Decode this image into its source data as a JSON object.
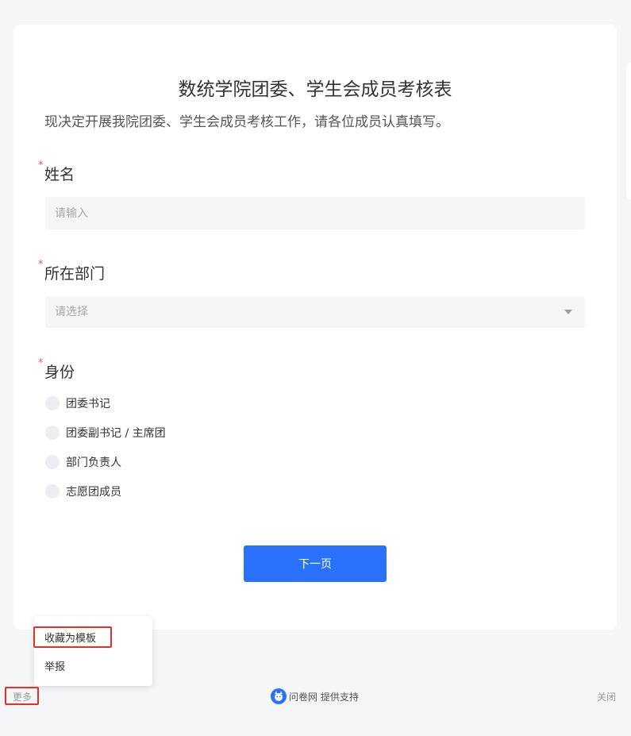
{
  "survey": {
    "title": "数统学院团委、学生会成员考核表",
    "description": "现决定开展我院团委、学生会成员考核工作，请各位成员认真填写。"
  },
  "questions": [
    {
      "required_mark": "*",
      "label": "姓名",
      "type": "text",
      "placeholder": "请输入",
      "value": ""
    },
    {
      "required_mark": "*",
      "label": "所在部门",
      "type": "select",
      "placeholder": "请选择",
      "value": ""
    },
    {
      "required_mark": "*",
      "label": "身份",
      "type": "radio",
      "options": [
        "团委书记",
        "团委副书记 / 主席团",
        "部门负责人",
        "志愿团成员"
      ]
    }
  ],
  "next_button": "下一页",
  "popup_menu": {
    "items": [
      "收藏为模板",
      "举报"
    ]
  },
  "footer": {
    "more_label": "更多",
    "brand_name": "问卷网",
    "brand_suffix": " 提供支持",
    "close_label": "关闭"
  },
  "colors": {
    "primary": "#2a72fb",
    "required": "#f25c54",
    "highlight": "#e33225",
    "background": "#f5f6f8"
  }
}
